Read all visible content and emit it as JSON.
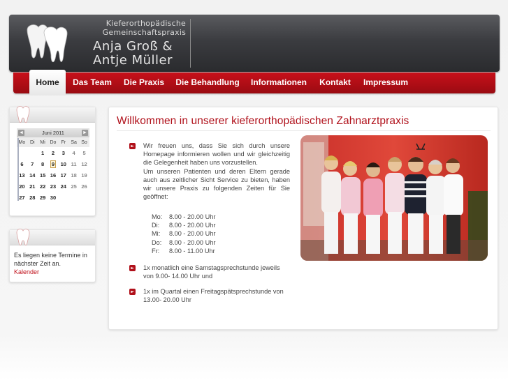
{
  "header": {
    "title_line1": "Kieferorthopädische",
    "title_line2": "Gemeinschaftspraxis",
    "names_line1": "Anja Groß &",
    "names_line2": "Antje Müller"
  },
  "nav": {
    "items": [
      {
        "label": "Home",
        "active": true
      },
      {
        "label": "Das Team"
      },
      {
        "label": "Die Praxis"
      },
      {
        "label": "Die Behandlung"
      },
      {
        "label": "Informationen"
      },
      {
        "label": "Kontakt"
      },
      {
        "label": "Impressum"
      }
    ]
  },
  "calendar": {
    "month": "Juni 2011",
    "prev": "◄",
    "next": "►",
    "weekdays": [
      "Mo",
      "Di",
      "Mi",
      "Do",
      "Fr",
      "Sa",
      "So"
    ],
    "weeks": [
      [
        "",
        "",
        "1",
        "2",
        "3",
        "4",
        "5"
      ],
      [
        "6",
        "7",
        "8",
        "9",
        "10",
        "11",
        "12"
      ],
      [
        "13",
        "14",
        "15",
        "16",
        "17",
        "18",
        "19"
      ],
      [
        "20",
        "21",
        "22",
        "23",
        "24",
        "25",
        "26"
      ],
      [
        "27",
        "28",
        "29",
        "30",
        "",
        "",
        ""
      ]
    ],
    "today": "9"
  },
  "termine": {
    "text": "Es liegen keine Termine in nächster Zeit an.",
    "link": "Kalender"
  },
  "main": {
    "title": "Willkommen in unserer kieferorthopädischen Zahnarztpraxis",
    "intro": "Wir freuen uns, dass Sie sich durch unsere Homepage informieren wollen und wir gleichzeitig die Gelegenheit haben uns vorzustellen.",
    "intro2": "Um unseren Patienten und deren Eltern gerade auch aus zeitlicher Sicht Service zu bieten, haben wir unsere Praxis zu folgenden Zeiten für Sie geöffnet:",
    "hours": [
      {
        "day": "Mo:",
        "time": "8.00 - 20.00 Uhr"
      },
      {
        "day": "Di:",
        "time": "8.00 - 20.00 Uhr"
      },
      {
        "day": "Mi:",
        "time": "8.00 - 20.00 Uhr"
      },
      {
        "day": "Do:",
        "time": "8.00 - 20.00 Uhr"
      },
      {
        "day": "Fr:",
        "time": "8.00 - 11.00 Uhr"
      }
    ],
    "note1": "1x monatlich eine Samstagsprechstunde jeweils von 9.00- 14.00 Uhr und",
    "note2": "1x im Quartal einen Freitagspätsprechstunde von 13.00- 20.00 Uhr"
  },
  "colors": {
    "accent": "#b0101a",
    "nav_red": "#c8101a",
    "header_dark": "#3b3c40"
  }
}
